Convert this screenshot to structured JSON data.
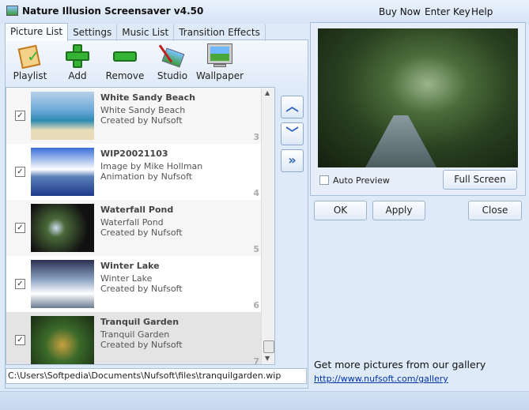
{
  "window": {
    "title": "Nature Illusion Screensaver v4.50",
    "menu": [
      "Buy Now",
      "Enter Key",
      "Help"
    ]
  },
  "tabs": [
    "Picture List",
    "Settings",
    "Music List",
    "Transition Effects"
  ],
  "toolbar": [
    {
      "label": "Playlist",
      "icon": "playlist-icon"
    },
    {
      "label": "Add",
      "icon": "add-icon"
    },
    {
      "label": "Remove",
      "icon": "remove-icon"
    },
    {
      "label": "Studio",
      "icon": "studio-icon"
    },
    {
      "label": "Wallpaper",
      "icon": "wallpaper-icon"
    }
  ],
  "list": [
    {
      "title": "White Sandy Beach",
      "line1": "White Sandy Beach",
      "line2": "Created by Nufsoft",
      "num": "3",
      "checked": true
    },
    {
      "title": "WIP20021103",
      "line1": "Image by Mike Hollman",
      "line2": "Animation by Nufsoft",
      "num": "4",
      "checked": true
    },
    {
      "title": "Waterfall Pond",
      "line1": "Waterfall Pond",
      "line2": "Created by Nufsoft",
      "num": "5",
      "checked": true
    },
    {
      "title": "Winter Lake",
      "line1": "Winter Lake",
      "line2": "Created by Nufsoft",
      "num": "6",
      "checked": true
    },
    {
      "title": "Tranquil Garden",
      "line1": "Tranquil Garden",
      "line2": "Created by Nufsoft",
      "num": "7",
      "checked": true,
      "selected": true
    }
  ],
  "path": "C:\\Users\\Softpedia\\Documents\\Nufsoft\\files\\tranquilgarden.wip",
  "preview": {
    "auto_preview_label": "Auto Preview",
    "auto_preview": false,
    "full_screen": "Full Screen"
  },
  "buttons": {
    "ok": "OK",
    "apply": "Apply",
    "close": "Close"
  },
  "gallery": {
    "text": "Get more pictures from our gallery",
    "link": "http://www.nufsoft.com/gallery"
  }
}
